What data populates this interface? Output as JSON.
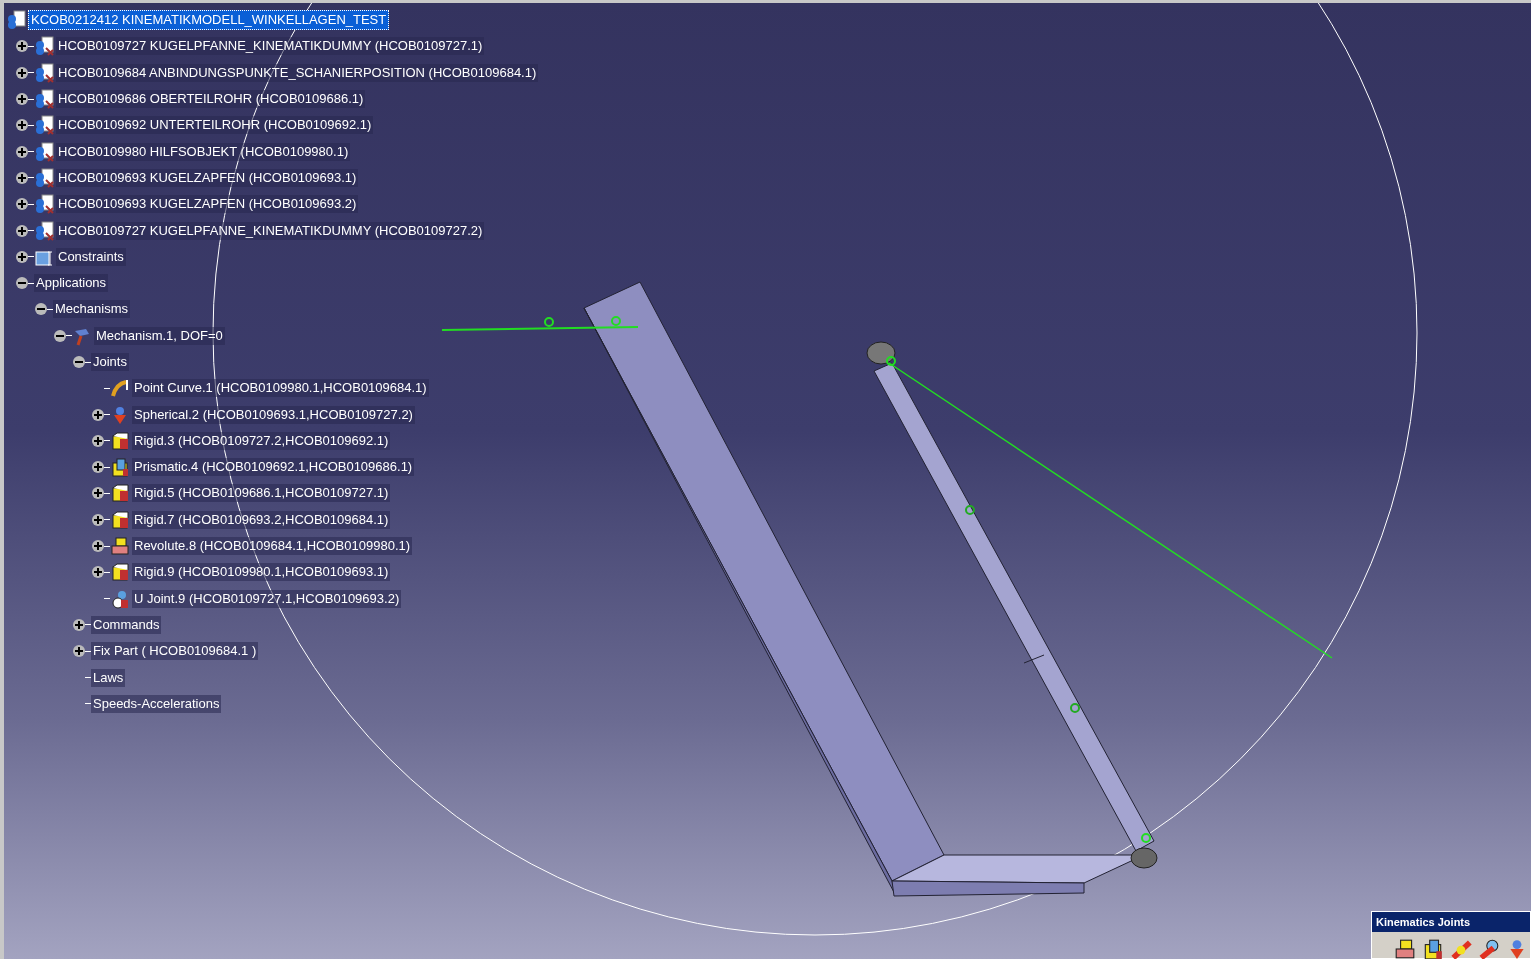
{
  "tree": {
    "label": "KCOB0212412 KINEMATIKMODELL_WINKELLAGEN_TEST",
    "kind": "product",
    "selected": true,
    "children": [
      {
        "label": "HCOB0109727 KUGELPFANNE_KINEMATIKDUMMY (HCOB0109727.1)",
        "kind": "part",
        "expanded": false,
        "selected": false
      },
      {
        "label": "HCOB0109684 ANBINDUNGSPUNKTE_SCHANIERPOSITION (HCOB0109684.1)",
        "kind": "part",
        "expanded": false,
        "selected": false
      },
      {
        "label": "HCOB0109686 OBERTEILROHR (HCOB0109686.1)",
        "kind": "part",
        "expanded": false,
        "selected": false
      },
      {
        "label": "HCOB0109692 UNTERTEILROHR (HCOB0109692.1)",
        "kind": "part",
        "expanded": false,
        "selected": false
      },
      {
        "label": "HCOB0109980 HILFSOBJEKT (HCOB0109980.1)",
        "kind": "part",
        "expanded": false,
        "selected": false
      },
      {
        "label": "HCOB0109693 KUGELZAPFEN (HCOB0109693.1)",
        "kind": "part",
        "expanded": false,
        "selected": false
      },
      {
        "label": "HCOB0109693 KUGELZAPFEN (HCOB0109693.2)",
        "kind": "part",
        "expanded": false,
        "selected": false
      },
      {
        "label": "HCOB0109727 KUGELPFANNE_KINEMATIKDUMMY (HCOB0109727.2)",
        "kind": "part",
        "expanded": false,
        "selected": false
      },
      {
        "label": "Constraints",
        "kind": "constraints",
        "expanded": false,
        "selected": false
      },
      {
        "label": "Applications",
        "expanded": true,
        "selected": false,
        "children": [
          {
            "label": "Mechanisms",
            "expanded": true,
            "selected": false,
            "children": [
              {
                "label": "Mechanism.1, DOF=0",
                "kind": "mechanism",
                "expanded": true,
                "selected": false,
                "children": [
                  {
                    "label": "Joints",
                    "expanded": true,
                    "selected": false,
                    "children": [
                      {
                        "label": "Point Curve.1 (HCOB0109980.1,HCOB0109684.1)",
                        "kind": "pointcurve",
                        "selected": false
                      },
                      {
                        "label": "Spherical.2 (HCOB0109693.1,HCOB0109727.2)",
                        "kind": "spherical",
                        "expanded": false,
                        "selected": false
                      },
                      {
                        "label": "Rigid.3 (HCOB0109727.2,HCOB0109692.1)",
                        "kind": "rigid",
                        "expanded": false,
                        "selected": false
                      },
                      {
                        "label": "Prismatic.4 (HCOB0109692.1,HCOB0109686.1)",
                        "kind": "prismatic",
                        "expanded": false,
                        "selected": false
                      },
                      {
                        "label": "Rigid.5 (HCOB0109686.1,HCOB0109727.1)",
                        "kind": "rigid",
                        "expanded": false,
                        "selected": false
                      },
                      {
                        "label": "Rigid.7 (HCOB0109693.2,HCOB0109684.1)",
                        "kind": "rigid",
                        "expanded": false,
                        "selected": false
                      },
                      {
                        "label": "Revolute.8 (HCOB0109684.1,HCOB0109980.1)",
                        "kind": "revolute",
                        "expanded": false,
                        "selected": false
                      },
                      {
                        "label": "Rigid.9 (HCOB0109980.1,HCOB0109693.1)",
                        "kind": "rigid",
                        "expanded": false,
                        "selected": false
                      },
                      {
                        "label": "U Joint.9 (HCOB0109727.1,HCOB0109693.2)",
                        "kind": "ujoint",
                        "selected": false
                      }
                    ]
                  },
                  {
                    "label": "Commands",
                    "expanded": false,
                    "selected": false
                  },
                  {
                    "label": "Fix Part ( HCOB0109684.1 )",
                    "expanded": false,
                    "selected": false
                  },
                  {
                    "label": "Laws",
                    "selected": false
                  },
                  {
                    "label": "Speeds-Accelerations",
                    "selected": false
                  }
                ]
              }
            ]
          }
        ]
      }
    ]
  },
  "toolbar": {
    "title": "Kinematics Joints",
    "tools": [
      {
        "kind": "revolute"
      },
      {
        "kind": "prismatic"
      },
      {
        "kind": "cylindrical"
      },
      {
        "kind": "screw"
      },
      {
        "kind": "spherical"
      }
    ]
  }
}
